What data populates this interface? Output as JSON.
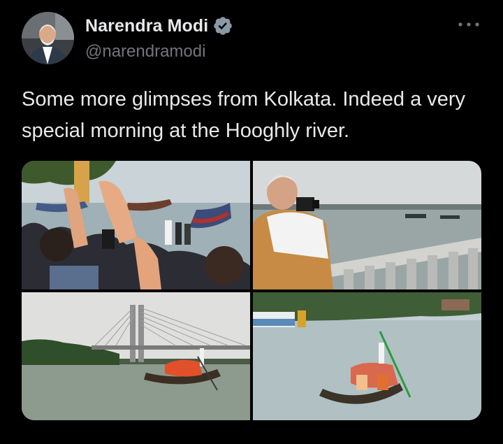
{
  "author": {
    "display_name": "Narendra Modi",
    "handle": "@narendramodi",
    "verified": true,
    "avatar_icon": "profile-photo",
    "verified_icon": "verified-badge-icon",
    "verified_color": "#8b98a5"
  },
  "tweet": {
    "text": "Some more glimpses from Kolkata. Indeed a very special morning at the Hooghly river.",
    "more_icon": "more-options-icon"
  },
  "media": [
    {
      "id": "photo-1",
      "type": "image"
    },
    {
      "id": "photo-2",
      "type": "image"
    },
    {
      "id": "photo-3",
      "type": "image"
    },
    {
      "id": "photo-4",
      "type": "image"
    }
  ],
  "colors": {
    "background": "#000000",
    "text": "#e7e9ea",
    "secondary_text": "#71767b"
  }
}
